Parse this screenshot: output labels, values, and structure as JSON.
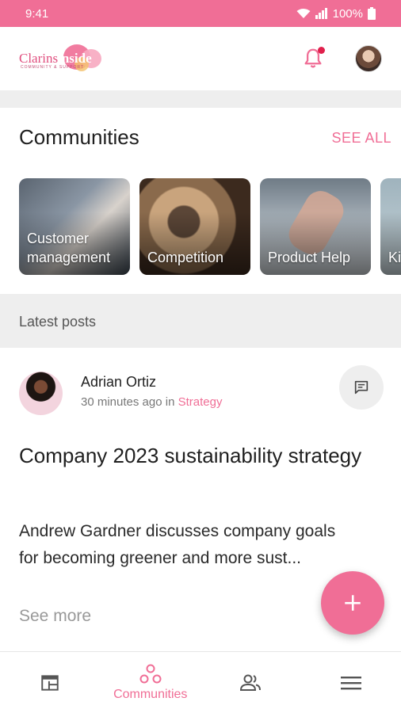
{
  "status_bar": {
    "time": "9:41",
    "battery": "100%"
  },
  "app_bar": {
    "logo_text_left": "Clarins",
    "logo_text_right": "inside",
    "logo_subtitle": "COMMUNITY & SUPPORT",
    "notification_badge": true
  },
  "communities": {
    "title": "Communities",
    "see_all": "SEE ALL",
    "cards": [
      {
        "label_line1": "Customer",
        "label_line2": "management"
      },
      {
        "label": "Competition"
      },
      {
        "label": "Product Help"
      },
      {
        "label": "Ki"
      }
    ]
  },
  "latest": {
    "label": "Latest posts",
    "post": {
      "author": "Adrian Ortiz",
      "time": "30 minutes ago",
      "in": "in",
      "category": "Strategy",
      "title": "Company 2023 sustainability strategy",
      "body": "Andrew Gardner discusses company goals for becoming greener and more sust...",
      "see_more": "See more"
    }
  },
  "bottom_nav": {
    "items": [
      {
        "label": ""
      },
      {
        "label": "Communities"
      },
      {
        "label": ""
      },
      {
        "label": ""
      }
    ]
  },
  "colors": {
    "accent": "#f06e96",
    "status_bar": "#f06e96",
    "badge": "#e0204c"
  }
}
